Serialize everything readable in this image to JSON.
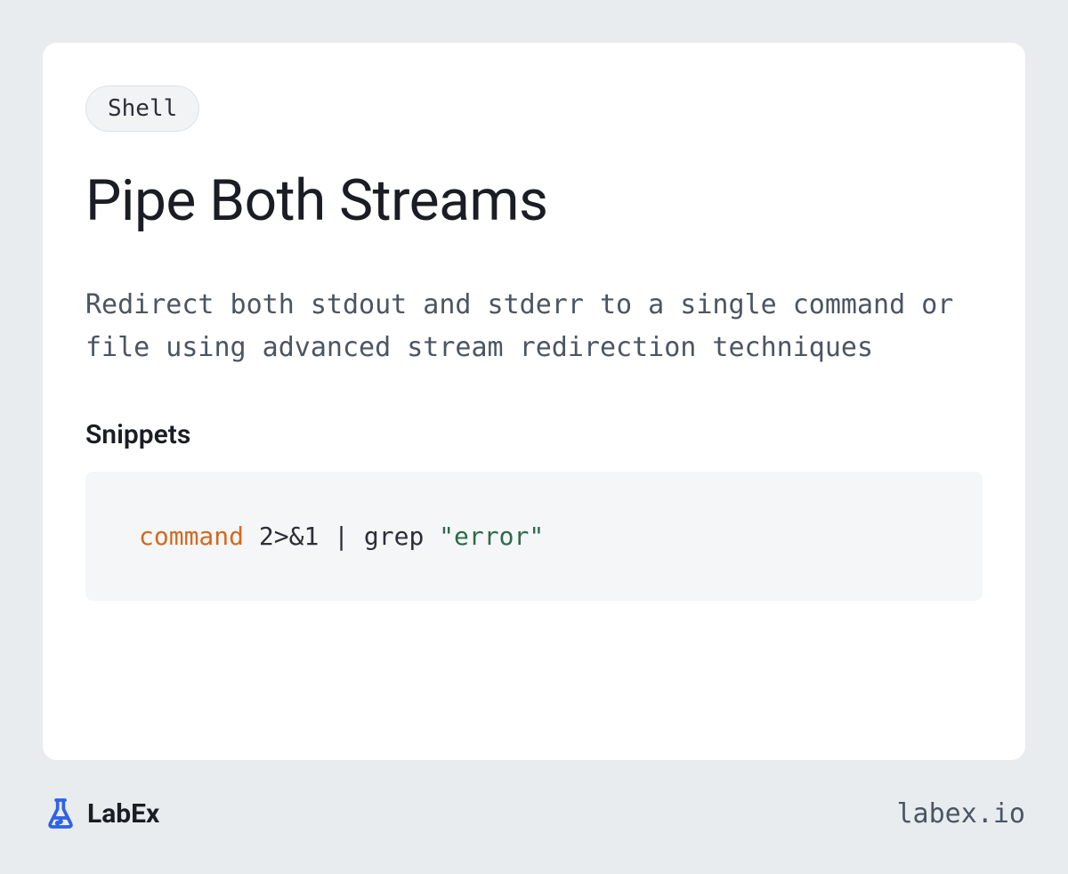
{
  "tag": "Shell",
  "title": "Pipe Both Streams",
  "description": "Redirect both stdout and stderr to a single command or file using advanced stream redirection techniques",
  "section_heading": "Snippets",
  "code": {
    "keyword": "command",
    "rest": " 2>&1 | grep ",
    "string": "\"error\""
  },
  "brand": {
    "name": "LabEx",
    "url": "labex.io"
  }
}
